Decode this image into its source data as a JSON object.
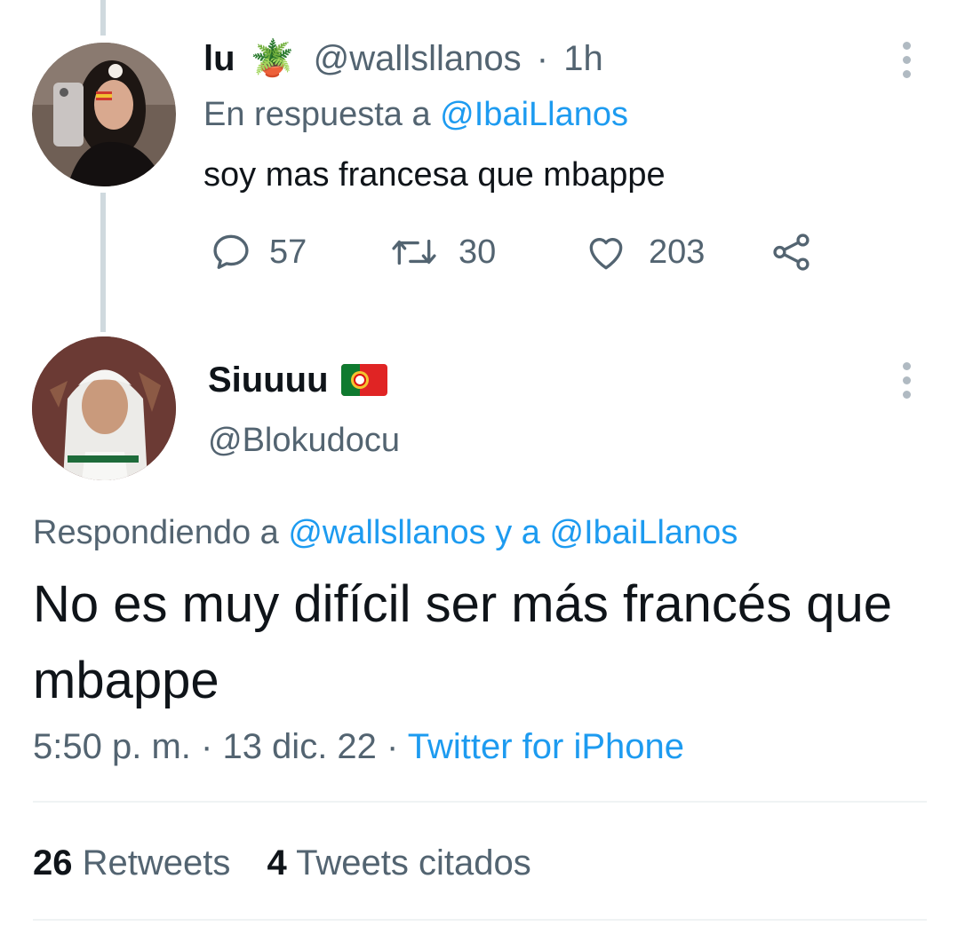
{
  "reply_tweet": {
    "author_name": "lu",
    "author_emoji": "🪴",
    "handle": "@wallsllanos",
    "separator": "·",
    "time": "1h",
    "reply_label": "En respuesta a",
    "reply_target": "@IbaiLlanos",
    "text": "soy mas francesa que mbappe",
    "actions": {
      "replies": "57",
      "retweets": "30",
      "likes": "203"
    }
  },
  "main_tweet": {
    "author_name": "Siuuuu",
    "author_flag": "portugal-flag",
    "handle": "@Blokudocu",
    "responding_label": "Respondiendo a",
    "responding_user1": "@wallsllanos",
    "responding_join": "y a",
    "responding_user2": "@IbaiLlanos",
    "text": "No es muy difícil ser más francés que mbappe",
    "time": "5:50 p. m.",
    "sep1": "·",
    "date": "13 dic. 22",
    "sep2": "·",
    "source": "Twitter for iPhone",
    "stats": {
      "retweets_count": "26",
      "retweets_label": "Retweets",
      "quotes_count": "4",
      "quotes_label": "Tweets citados"
    }
  },
  "colors": {
    "link": "#1d9bf0",
    "muted": "#536471",
    "text": "#0f1419",
    "thread_line": "#cfd9de"
  }
}
